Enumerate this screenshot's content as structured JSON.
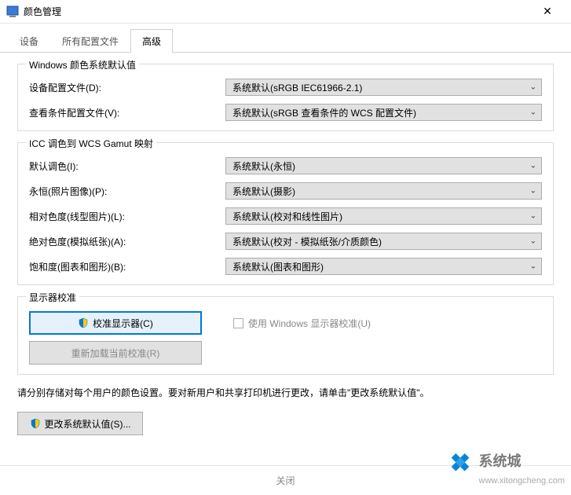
{
  "window": {
    "title": "颜色管理",
    "close_glyph": "✕"
  },
  "tabs": [
    "设备",
    "所有配置文件",
    "高级"
  ],
  "active_tab": 2,
  "group1": {
    "title": "Windows 颜色系统默认值",
    "rows": [
      {
        "label": "设备配置文件(D):",
        "value": "系统默认(sRGB IEC61966-2.1)"
      },
      {
        "label": "查看条件配置文件(V):",
        "value": "系统默认(sRGB 查看条件的 WCS 配置文件)"
      }
    ]
  },
  "group2": {
    "title": "ICC 调色到 WCS Gamut 映射",
    "rows": [
      {
        "label": "默认调色(I):",
        "value": "系统默认(永恒)"
      },
      {
        "label": "永恒(照片图像)(P):",
        "value": "系统默认(摄影)"
      },
      {
        "label": "相对色度(线型图片)(L):",
        "value": "系统默认(校对和线性图片)"
      },
      {
        "label": "绝对色度(模拟纸张)(A):",
        "value": "系统默认(校对 - 模拟纸张/介质颜色)"
      },
      {
        "label": "饱和度(图表和图形)(B):",
        "value": "系统默认(图表和图形)"
      }
    ]
  },
  "group3": {
    "title": "显示器校准",
    "calibrate_btn": "校准显示器(C)",
    "use_windows_calib_label": "使用 Windows 显示器校准(U)",
    "reload_btn": "重新加载当前校准(R)"
  },
  "note_text": "请分别存储对每个用户的颜色设置。要对新用户和共享打印机进行更改，请单击\"更改系统默认值\"。",
  "change_defaults_btn": "更改系统默认值(S)...",
  "footer_close": "关闭",
  "watermark": {
    "label": "系统城",
    "sub": "www.xitongcheng.com"
  }
}
